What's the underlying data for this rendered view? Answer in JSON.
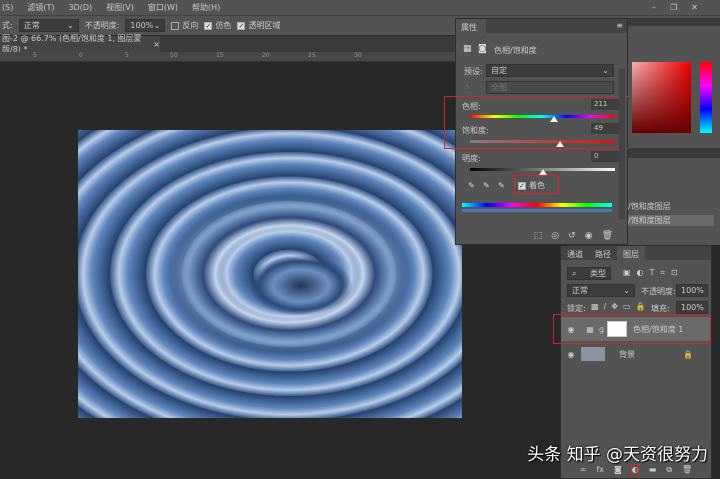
{
  "menu": [
    "(S)",
    "滤镜(T)",
    "3D(D)",
    "视图(V)",
    "窗口(W)",
    "帮助(H)"
  ],
  "options": {
    "mode_label": "式:",
    "mode_value": "正常",
    "opacity_label": "不透明度:",
    "opacity_value": "100%",
    "reverse": "反向",
    "dither": "仿色",
    "transparency": "透明区域"
  },
  "doc_tab": {
    "title": "图-2 @ 66.7% (色相/饱和度 1, 图层蒙版/8) *",
    "close": "×"
  },
  "ruler": [
    "5",
    "0",
    "5",
    "10",
    "15",
    "20",
    "25",
    "30"
  ],
  "properties": {
    "tab": "属性",
    "adj_name": "色相/饱和度",
    "preset_label": "预设:",
    "preset_value": "自定",
    "channel_value": "全图",
    "hue_label": "色相:",
    "hue_value": "211",
    "hue_fraction": 0.58,
    "sat_label": "饱和度:",
    "sat_value": "49",
    "sat_fraction": 0.62,
    "light_label": "明度:",
    "light_value": "0",
    "light_fraction": 0.5,
    "colorize_label": "着色",
    "colorize_checked": true
  },
  "right_panel": {
    "items": [
      "/饱和度图层",
      "/饱和度图层"
    ]
  },
  "layers": {
    "tabs": [
      "通道",
      "路径",
      "图层"
    ],
    "filter_label": "类型",
    "blend_mode": "正常",
    "opacity_label": "不透明度:",
    "opacity_value": "100%",
    "lock_label": "锁定:",
    "fill_label": "填充:",
    "fill_value": "100%",
    "items": [
      {
        "name": "色相/饱和度 1",
        "selected": true
      },
      {
        "name": "背景",
        "locked": true
      }
    ]
  },
  "watermark": "头条 知乎 @天资很努力"
}
